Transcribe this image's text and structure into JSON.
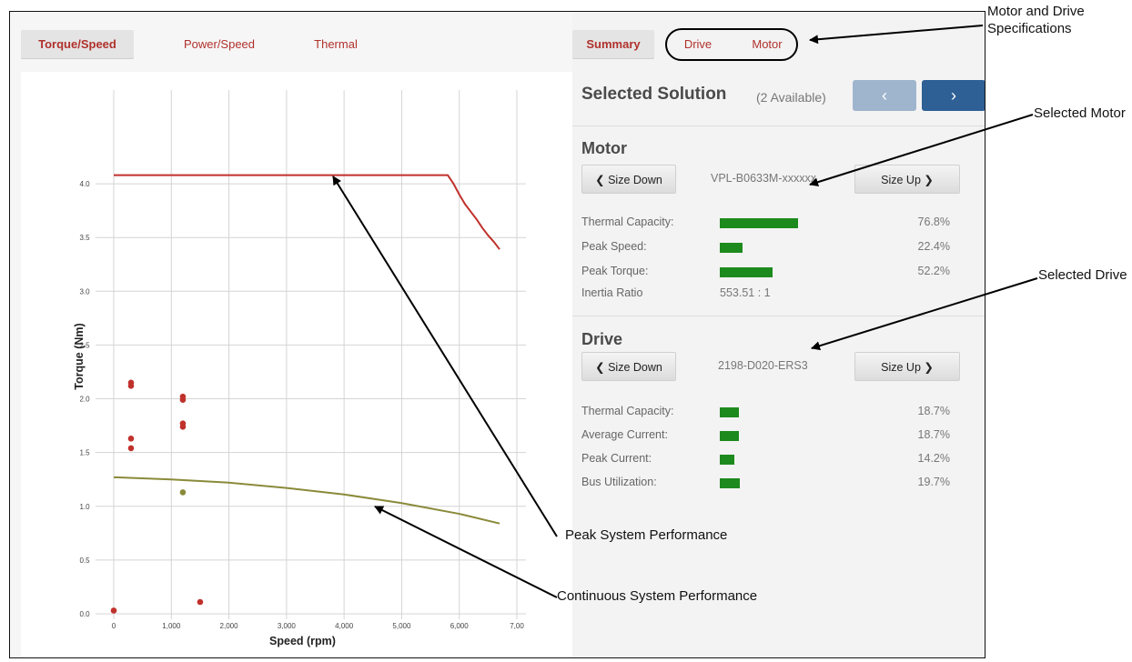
{
  "chart_tabs": [
    "Torque/Speed",
    "Power/Speed",
    "Thermal"
  ],
  "spec_tabs": {
    "summary": "Summary",
    "drive": "Drive",
    "motor": "Motor"
  },
  "selected_solution": {
    "title": "Selected Solution",
    "available": "(2 Available)",
    "prev_icon": "‹",
    "next_icon": "›"
  },
  "motor": {
    "header": "Motor",
    "size_down": "Size Down",
    "size_up": "Size Up",
    "part": "VPL-B0633M-xxxxxx",
    "rows": [
      {
        "label": "Thermal Capacity:",
        "value": "76.8%",
        "fraction": 0.768
      },
      {
        "label": "Peak Speed:",
        "value": "22.4%",
        "fraction": 0.224
      },
      {
        "label": "Peak Torque:",
        "value": "52.2%",
        "fraction": 0.522
      }
    ],
    "inertia_label": "Inertia Ratio",
    "inertia_value": "553.51 : 1"
  },
  "drive": {
    "header": "Drive",
    "size_down": "Size Down",
    "size_up": "Size Up",
    "part": "2198-D020-ERS3",
    "rows": [
      {
        "label": "Thermal Capacity:",
        "value": "18.7%",
        "fraction": 0.187
      },
      {
        "label": "Average Current:",
        "value": "18.7%",
        "fraction": 0.187
      },
      {
        "label": "Peak Current:",
        "value": "14.2%",
        "fraction": 0.142
      },
      {
        "label": "Bus Utilization:",
        "value": "19.7%",
        "fraction": 0.197
      }
    ]
  },
  "annotations": {
    "motor_drive_specs": [
      "Motor and Drive",
      "Specifications"
    ],
    "selected_motor": "Selected Motor",
    "selected_drive": "Selected Drive",
    "peak_perf": "Peak System Performance",
    "cont_perf": "Continuous System Performance"
  },
  "colors": {
    "tab_text": "#b0312c",
    "bar": "#1d8a1d",
    "nav_next": "#2e5f95",
    "nav_prev": "#9fb5cd",
    "peak_line": "#c0312b",
    "cont_line": "#8a8a3a"
  },
  "chart_data": {
    "type": "line",
    "xlabel": "Speed (rpm)",
    "ylabel": "Torque (Nm)",
    "xlim": [
      0,
      7000
    ],
    "ylim": [
      0,
      4.5
    ],
    "x_ticks": [
      "0",
      "1,000",
      "2,000",
      "3,000",
      "4,000",
      "5,000",
      "6,000",
      "7,00"
    ],
    "y_ticks": [
      "0.0",
      "0.5",
      "1.0",
      "1.5",
      "2.0",
      "2.5",
      "3.0",
      "3.5",
      "4.0"
    ],
    "grid": true,
    "series": [
      {
        "color": "#c0312b",
        "x": [
          0,
          5800,
          5900,
          6000,
          6100,
          6200,
          6300,
          6400,
          6500,
          6600,
          6700
        ],
        "y": [
          4.08,
          4.08,
          4.0,
          3.9,
          3.81,
          3.74,
          3.67,
          3.59,
          3.52,
          3.46,
          3.39
        ]
      },
      {
        "color": "#8a8a3a",
        "x": [
          0,
          1000,
          2000,
          3000,
          4000,
          5000,
          6000,
          6700
        ],
        "y": [
          1.27,
          1.25,
          1.22,
          1.17,
          1.11,
          1.03,
          0.93,
          0.84
        ]
      }
    ],
    "points": [
      {
        "x": 0,
        "y": 0.03,
        "color": "#c0312b"
      },
      {
        "x": 300,
        "y": 2.15,
        "color": "#c0312b"
      },
      {
        "x": 300,
        "y": 2.12,
        "color": "#c0312b"
      },
      {
        "x": 300,
        "y": 1.63,
        "color": "#c0312b"
      },
      {
        "x": 300,
        "y": 1.54,
        "color": "#c0312b"
      },
      {
        "x": 1200,
        "y": 2.02,
        "color": "#c0312b"
      },
      {
        "x": 1200,
        "y": 1.99,
        "color": "#c0312b"
      },
      {
        "x": 1200,
        "y": 1.77,
        "color": "#c0312b"
      },
      {
        "x": 1200,
        "y": 1.74,
        "color": "#c0312b"
      },
      {
        "x": 1200,
        "y": 1.13,
        "color": "#8a8a3a"
      },
      {
        "x": 1500,
        "y": 0.11,
        "color": "#c0312b"
      }
    ]
  }
}
